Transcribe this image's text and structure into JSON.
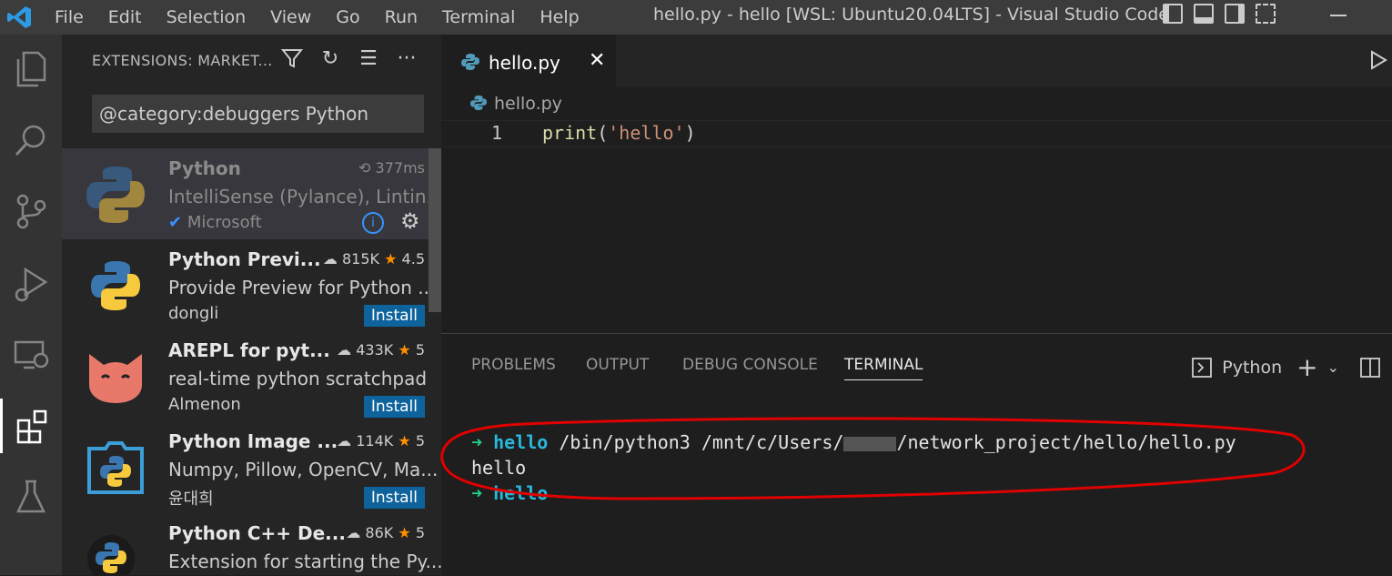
{
  "window": {
    "title": "hello.py - hello [WSL: Ubuntu20.04LTS] - Visual Studio Code",
    "menu": [
      "File",
      "Edit",
      "Selection",
      "View",
      "Go",
      "Run",
      "Terminal",
      "Help"
    ]
  },
  "activity_bar": {
    "icons": [
      "files-icon",
      "search-icon",
      "source-control-icon",
      "run-debug-icon",
      "remote-explorer-icon",
      "extensions-icon",
      "testing-icon"
    ]
  },
  "sidebar": {
    "title": "EXTENSIONS: MARKET...",
    "search_value": "@category:debuggers Python",
    "extensions": [
      {
        "name": "Python",
        "stat": "377ms",
        "description": "IntelliSense (Pylance), Lintin...",
        "publisher": "Microsoft",
        "installed": true
      },
      {
        "name": "Python Previ...",
        "downloads": "815K",
        "rating": "4.5",
        "description": "Provide Preview for Python ...",
        "publisher": "dongli",
        "action": "Install"
      },
      {
        "name": "AREPL for pyt...",
        "downloads": "433K",
        "rating": "5",
        "description": "real-time python scratchpad",
        "publisher": "Almenon",
        "action": "Install"
      },
      {
        "name": "Python Image ...",
        "downloads": "114K",
        "rating": "5",
        "description": "Numpy, Pillow, OpenCV, Ma...",
        "publisher": "윤대희",
        "action": "Install"
      },
      {
        "name": "Python C++ De...",
        "downloads": "86K",
        "rating": "5",
        "description": "Extension for starting the Py...",
        "publisher": "",
        "action": ""
      }
    ]
  },
  "editor": {
    "tab_label": "hello.py",
    "breadcrumb": "hello.py",
    "line_number": "1",
    "code": {
      "fn": "print",
      "open": "(",
      "str": "'hello'",
      "close": ")"
    }
  },
  "panel": {
    "tabs": [
      "PROBLEMS",
      "OUTPUT",
      "DEBUG CONSOLE",
      "TERMINAL"
    ],
    "active_tab": "TERMINAL",
    "terminal_profile": "Python",
    "terminal_lines": [
      {
        "arrow": "➜",
        "dir": "hello",
        "cmd_pre": "/bin/python3 /mnt/c/Users/",
        "cmd_post": "/network_project/hello/hello.py"
      },
      {
        "output": "hello"
      },
      {
        "arrow": "➜",
        "dir": "hello"
      }
    ]
  },
  "annotation_color": "#e00000"
}
